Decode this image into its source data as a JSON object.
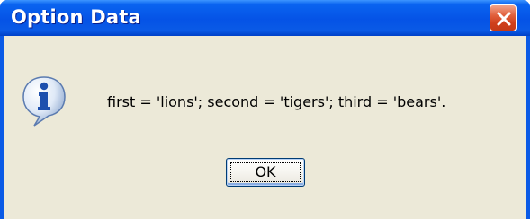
{
  "window": {
    "title": "Option Data",
    "colors": {
      "titlebar": "#0a5ae6",
      "client_background": "#ece9d8",
      "close_button": "#d0401c"
    }
  },
  "dialog": {
    "icon": "info-icon",
    "message": "first = 'lions'; second = 'tigers'; third = 'bears'.",
    "ok_label": "OK"
  },
  "titlebar_controls": {
    "close_icon": "close-icon"
  }
}
